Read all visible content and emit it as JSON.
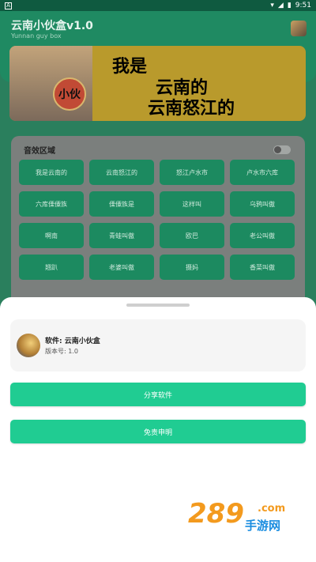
{
  "status_bar": {
    "notif_letter": "A",
    "time": "9:51"
  },
  "header": {
    "title": "云南小伙盒v1.0",
    "subtitle": "Yunnan guy box"
  },
  "banner": {
    "line1": "我是",
    "line2": "云南的",
    "line3": "云南怒江的",
    "tag": "小伙"
  },
  "sound_panel": {
    "title": "音效区域",
    "buttons": [
      "我是云南的",
      "云南怒江的",
      "怒江卢水市",
      "卢水市六库",
      "六库傈僳族",
      "傈僳族是",
      "这样叫",
      "乌鸦叫傲",
      "啊南",
      "青蛙叫傲",
      "欧巴",
      "老公叫傲",
      "翘趴",
      "老婆叫傲",
      "摄妈",
      "香菜叫傲"
    ]
  },
  "sheet": {
    "app_name": "软件: 云南小伙盒",
    "version": "版本号: 1.0",
    "share_label": "分享软件",
    "disclaimer_label": "免责申明"
  },
  "watermark": {
    "number": "289",
    "domain": ".com",
    "text": "手游网"
  }
}
